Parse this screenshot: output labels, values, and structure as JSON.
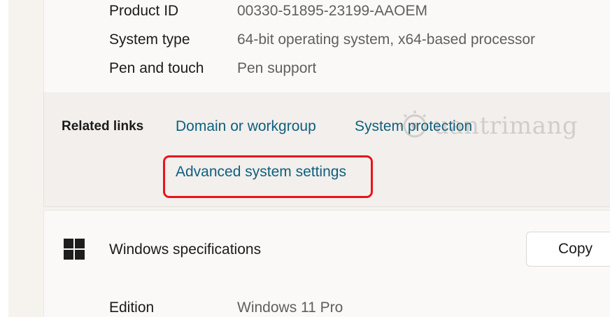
{
  "device_specs": [
    {
      "label": "Product ID",
      "value": "00330-51895-23199-AAOEM"
    },
    {
      "label": "System type",
      "value": "64-bit operating system, x64-based processor"
    },
    {
      "label": "Pen and touch",
      "value": "Pen support"
    }
  ],
  "related_links": {
    "label": "Related links",
    "domain_link": "Domain or workgroup",
    "protection_link": "System protection",
    "advanced_link": "Advanced system settings"
  },
  "windows_specs": {
    "title": "Windows specifications",
    "copy_label": "Copy",
    "edition_label": "Edition",
    "edition_value": "Windows 11 Pro"
  },
  "watermark": {
    "text": "uantrimang"
  },
  "colors": {
    "link": "#0f5f7e",
    "highlight": "#e8141b",
    "card": "#fbf9f7",
    "links_card": "#f2efec"
  }
}
